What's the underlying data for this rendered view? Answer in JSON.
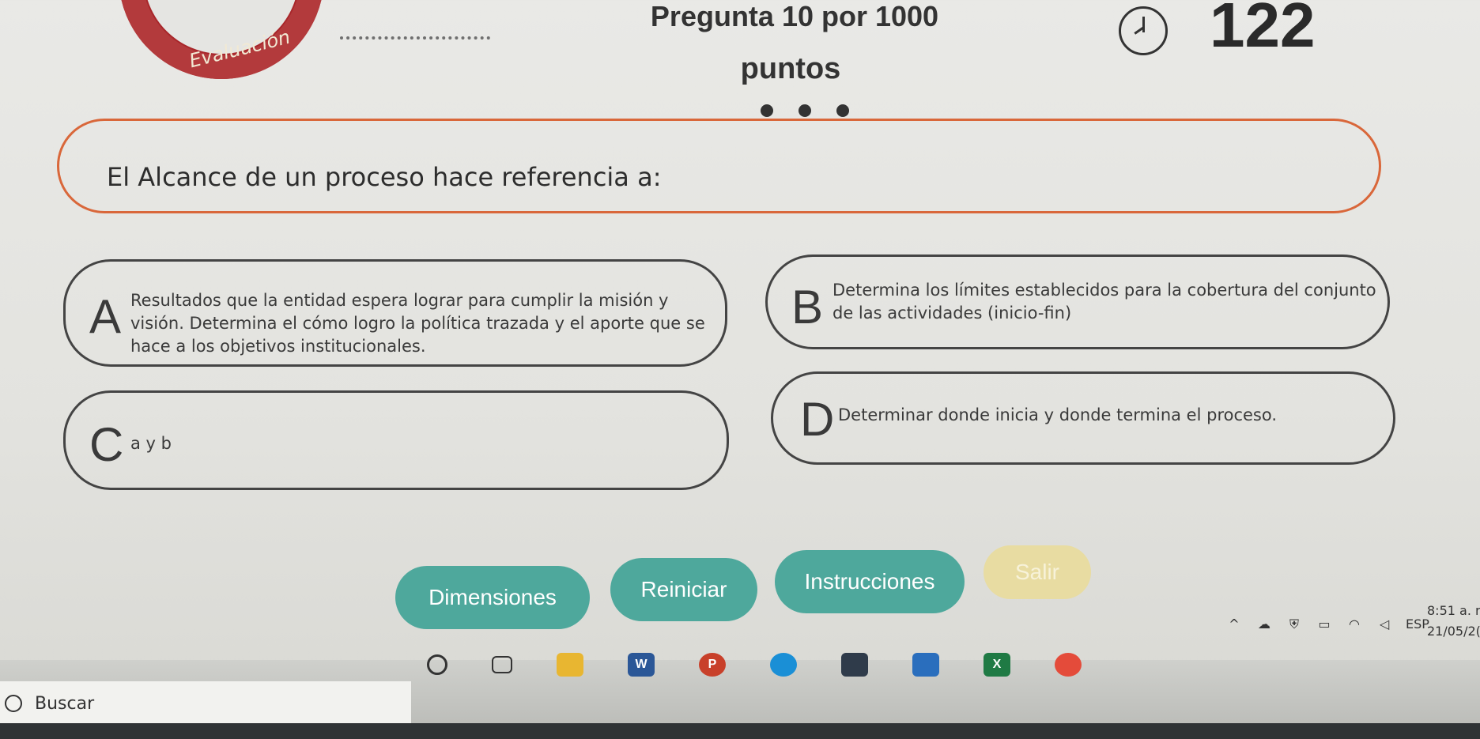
{
  "header": {
    "section_label": "Evaluación",
    "points_title": "Pregunta 10 por 1000",
    "points_unit": "puntos",
    "timer_icon": "timer-icon",
    "counter": "122"
  },
  "question": {
    "text": "El Alcance de un proceso hace referencia a:"
  },
  "options": [
    {
      "letter": "A",
      "text": "Resultados que la entidad espera lograr para cumplir la misión y visión. Determina el cómo logro la política trazada y el aporte que se hace a los objetivos institucionales."
    },
    {
      "letter": "B",
      "text": "Determina los límites establecidos para la cobertura del conjunto de las actividades (inicio-fin)"
    },
    {
      "letter": "C",
      "text": "a y b"
    },
    {
      "letter": "D",
      "text": "Determinar donde inicia y donde termina el proceso."
    }
  ],
  "buttons": {
    "dimensions": "Dimensiones",
    "restart": "Reiniciar",
    "instructions": "Instrucciones",
    "exit": "Salir"
  },
  "colors": {
    "accent_orange": "#d9673a",
    "button_teal": "#4ea89c",
    "exit_yellow": "#e8dca2",
    "ring_red": "#a8262a"
  },
  "taskbar": {
    "search_placeholder": "Buscar",
    "language": "ESP",
    "time": "8:51 a. r",
    "date": "21/05/2("
  }
}
